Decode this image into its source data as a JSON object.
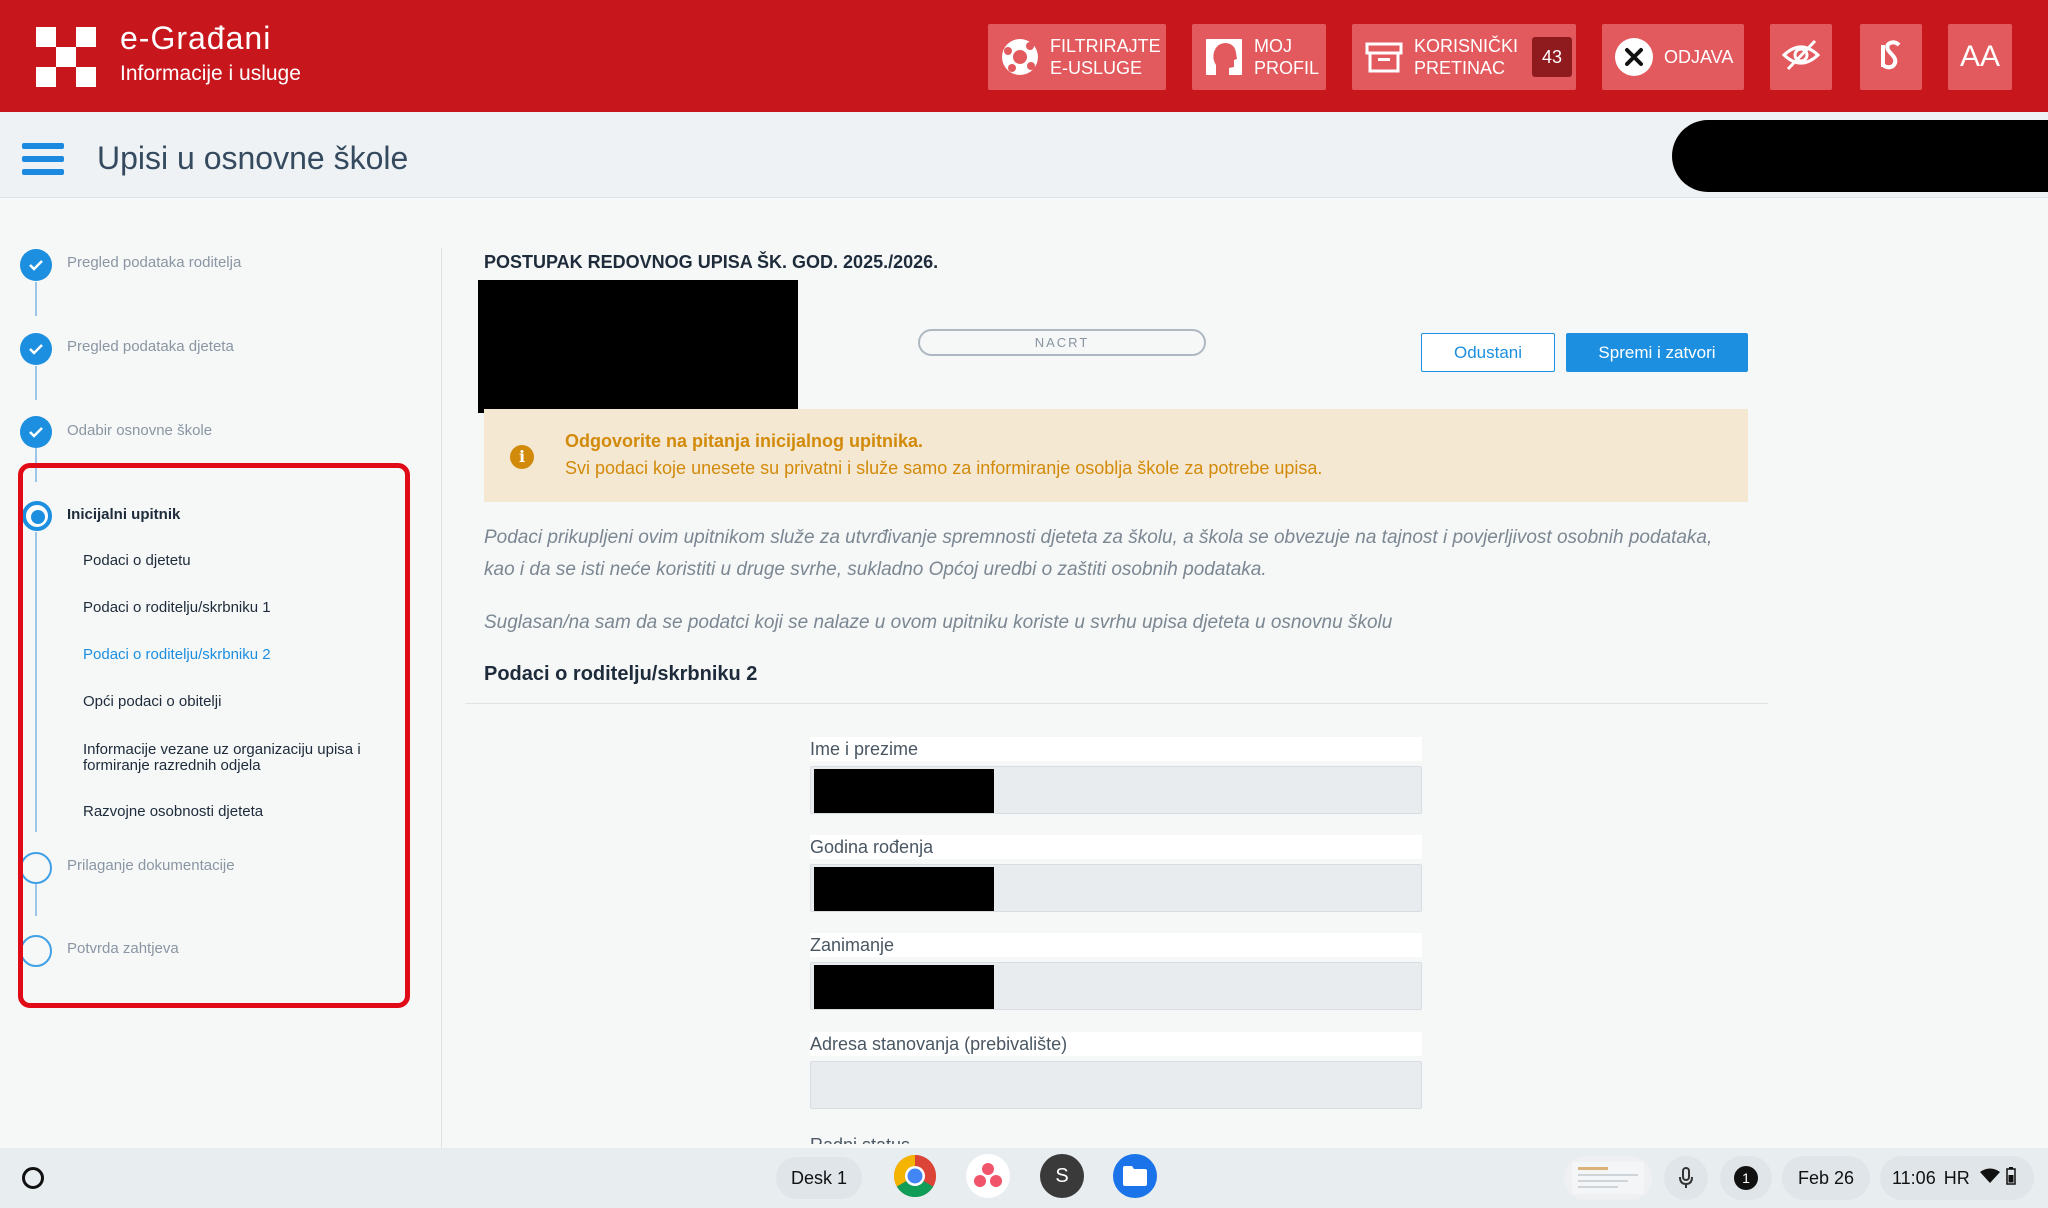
{
  "header": {
    "brand_title": "e-Građani",
    "brand_subtitle": "Informacije i usluge",
    "filter_line1": "FILTRIRAJTE",
    "filter_line2": "E-USLUGE",
    "profile_line1": "MOJ",
    "profile_line2": "PROFIL",
    "inbox_line1": "KORISNIČKI",
    "inbox_line2": "PRETINAC",
    "inbox_count": "43",
    "logout_label": "ODJAVA",
    "font_size_label": "AA",
    "accent_color": "#c8161d"
  },
  "subheader": {
    "title": "Upisi u osnovne škole"
  },
  "sidebar": {
    "steps": [
      {
        "label": "Pregled podataka roditelja",
        "state": "done"
      },
      {
        "label": "Pregled podataka djeteta",
        "state": "done"
      },
      {
        "label": "Odabir osnovne škole",
        "state": "done"
      },
      {
        "label": "Inicijalni upitnik",
        "state": "active"
      },
      {
        "label": "Prilaganje dokumentacije",
        "state": "pending"
      },
      {
        "label": "Potvrda zahtjeva",
        "state": "pending"
      }
    ],
    "substeps": [
      {
        "label": "Podaci o djetetu"
      },
      {
        "label": "Podaci o roditelju/skrbniku 1"
      },
      {
        "label": "Podaci o roditelju/skrbniku 2"
      },
      {
        "label": "Opći podaci o obitelji"
      },
      {
        "label": "Informacije vezane uz organizaciju upisa i formiranje razrednih odjela"
      },
      {
        "label": "Razvojne osobnosti djeteta"
      }
    ]
  },
  "main": {
    "procedure_title": "POSTUPAK REDOVNOG UPISA ŠK. GOD. 2025./2026.",
    "status": "NACRT",
    "cancel_label": "Odustani",
    "save_label": "Spremi i zatvori",
    "alert_title": "Odgovorite na pitanja inicijalnog upitnika.",
    "alert_text": "Svi podaci koje unesete su privatni i služe samo za informiranje osoblja škole za potrebe upisa.",
    "intro_p1_line1": "Podaci prikupljeni ovim upitnikom služe za utvrđivanje spremnosti djeteta za školu, a škola se obvezuje na tajnost i povjerljivost osobnih podataka,",
    "intro_p1_line2": "kao i da se isti neće koristiti u druge svrhe, sukladno Općoj uredbi o zaštiti osobnih podataka.",
    "intro_p2": "Suglasan/na sam da se podatci koji se nalaze u ovom upitniku koriste u svrhu upisa djeteta u osnovnu školu",
    "section_title": "Podaci o roditelju/skrbniku 2",
    "fields": [
      {
        "label": "Ime i prezime",
        "value": ""
      },
      {
        "label": "Godina rođenja",
        "value": ""
      },
      {
        "label": "Zanimanje",
        "value": ""
      },
      {
        "label": "Adresa stanovanja (prebivalište)",
        "value": ""
      }
    ],
    "next_field_label": "Radni status"
  },
  "taskbar": {
    "desk_label": "Desk 1",
    "notifications_count": "1",
    "date": "Feb 26",
    "time": "11:06",
    "locale": "HR"
  }
}
